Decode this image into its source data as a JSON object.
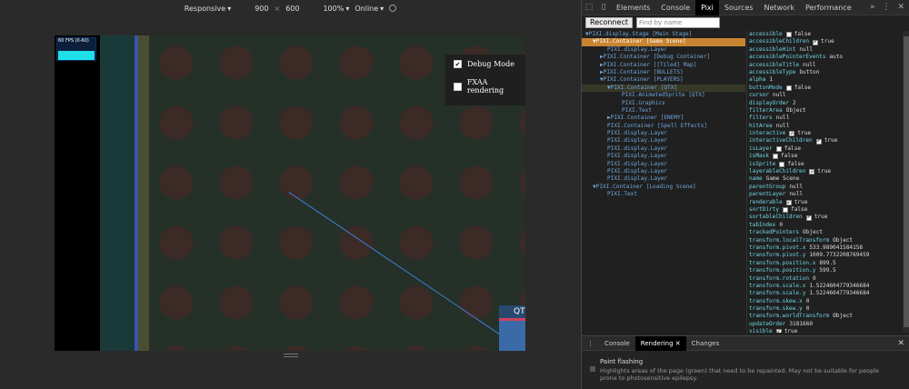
{
  "device_toolbar": {
    "device": "Responsive",
    "width": "900",
    "times": "×",
    "height": "600",
    "zoom": "100%",
    "network": "Online"
  },
  "game": {
    "fps_label": "60 FPS (0-60)",
    "options": [
      {
        "label": "Debug Mode",
        "checked": true
      },
      {
        "label": "FXAA rendering",
        "checked": false
      }
    ],
    "sprite_label": "QT"
  },
  "devtools_tabs": [
    "Elements",
    "Console",
    "Pixi",
    "Sources",
    "Network",
    "Performance"
  ],
  "devtools_active_tab": "Pixi",
  "more_label": "»",
  "pixi": {
    "reconnect_label": "Reconnect",
    "find_placeholder": "Find by name",
    "tree": [
      {
        "text": "▼PIXI.display.Stage [Main Stage]",
        "indent": 0
      },
      {
        "text": "▼PIXI.Container [Game Scene]",
        "indent": 1,
        "selected": true
      },
      {
        "text": "PIXI.display.Layer",
        "indent": 3
      },
      {
        "text": "▶PIXI.Container [Debug Container]",
        "indent": 2
      },
      {
        "text": "▶PIXI.Container [[Tiled] Map]",
        "indent": 2
      },
      {
        "text": "▶PIXI.Container [BULLETS]",
        "indent": 2
      },
      {
        "text": "▼PIXI.Container [PLAYERS]",
        "indent": 2
      },
      {
        "text": "▼PIXI.Container [QTX]",
        "indent": 3,
        "hl": true
      },
      {
        "text": "PIXI.AnimatedSprite [QTX]",
        "indent": 5
      },
      {
        "text": "PIXI.Graphics",
        "indent": 5
      },
      {
        "text": "PIXI.Text",
        "indent": 5
      },
      {
        "text": "▶PIXI.Container [ENEMY]",
        "indent": 3
      },
      {
        "text": "PIXI.Container [Spell Effects]",
        "indent": 3
      },
      {
        "text": "PIXI.display.Layer",
        "indent": 3
      },
      {
        "text": "PIXI.display.Layer",
        "indent": 3
      },
      {
        "text": "PIXI.display.Layer",
        "indent": 3
      },
      {
        "text": "PIXI.display.Layer",
        "indent": 3
      },
      {
        "text": "PIXI.display.Layer",
        "indent": 3
      },
      {
        "text": "PIXI.display.Layer",
        "indent": 3
      },
      {
        "text": "PIXI.display.Layer",
        "indent": 3
      },
      {
        "text": "▼PIXI.Container [Loading Scene]",
        "indent": 1
      },
      {
        "text": "PIXI.Text",
        "indent": 3
      }
    ],
    "props": [
      {
        "k": "accessible",
        "cb": false,
        "v": "false"
      },
      {
        "k": "accessibleChildren",
        "cb": true,
        "v": "true"
      },
      {
        "k": "accessibleHint",
        "v": "null"
      },
      {
        "k": "accessiblePointerEvents",
        "v": "auto"
      },
      {
        "k": "accessibleTitle",
        "v": "null"
      },
      {
        "k": "accessibleType",
        "v": "button"
      },
      {
        "k": "alpha",
        "v": "1"
      },
      {
        "k": "buttonMode",
        "cb": false,
        "v": "false"
      },
      {
        "k": "cursor",
        "v": "null"
      },
      {
        "k": "displayOrder",
        "v": "2"
      },
      {
        "k": "filterArea",
        "v": "Object"
      },
      {
        "k": "filters",
        "v": "null"
      },
      {
        "k": "hitArea",
        "v": "null"
      },
      {
        "k": "interactive",
        "cb": true,
        "v": "true"
      },
      {
        "k": "interactiveChildren",
        "cb": true,
        "v": "true"
      },
      {
        "k": "isLayer",
        "cb": false,
        "v": "false"
      },
      {
        "k": "isMask",
        "cb": false,
        "v": "false"
      },
      {
        "k": "isSprite",
        "cb": false,
        "v": "false"
      },
      {
        "k": "layerableChildren",
        "cb": true,
        "v": "true"
      },
      {
        "k": "name",
        "v": "Game Scene"
      },
      {
        "k": "parentGroup",
        "v": "null"
      },
      {
        "k": "parentLayer",
        "v": "null"
      },
      {
        "k": "renderable",
        "cb": true,
        "v": "true"
      },
      {
        "k": "sortDirty",
        "cb": false,
        "v": "false"
      },
      {
        "k": "sortableChildren",
        "cb": true,
        "v": "true"
      },
      {
        "k": "tabIndex",
        "v": "0"
      },
      {
        "k": "trackedPointers",
        "v": "Object"
      },
      {
        "k": "transform.localTransform",
        "v": "Object"
      },
      {
        "k": "transform.pivot.x",
        "v": "533.989041584158"
      },
      {
        "k": "transform.pivot.y",
        "v": "1009.7732208769459"
      },
      {
        "k": "transform.position.x",
        "v": "899.5"
      },
      {
        "k": "transform.position.y",
        "v": "599.5"
      },
      {
        "k": "transform.rotation",
        "v": "0"
      },
      {
        "k": "transform.scale.x",
        "v": "1.5224604779346684"
      },
      {
        "k": "transform.scale.y",
        "v": "1.5224604779346684"
      },
      {
        "k": "transform.skew.x",
        "v": "0"
      },
      {
        "k": "transform.skew.y",
        "v": "0"
      },
      {
        "k": "transform.worldTransform",
        "v": "Object"
      },
      {
        "k": "updateOrder",
        "v": "3181660"
      },
      {
        "k": "visible",
        "cb": true,
        "v": "true"
      }
    ]
  },
  "drawer": {
    "tabs": [
      "Console",
      "Rendering",
      "Changes"
    ],
    "active": "Rendering",
    "paint_title": "Paint flashing",
    "paint_desc": "Highlights areas of the page (green) that need to be repainted. May not be suitable for people prone to photosensitive epilepsy."
  }
}
